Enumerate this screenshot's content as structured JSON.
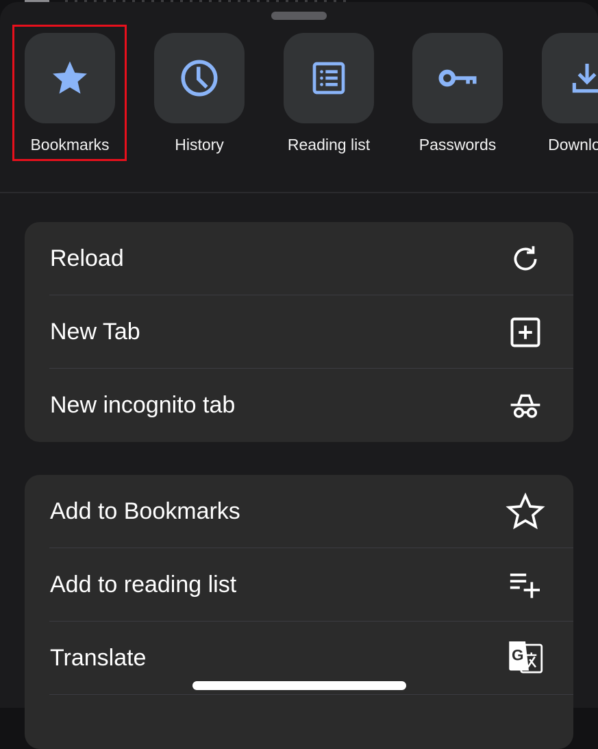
{
  "sheet": {
    "shortcuts": [
      {
        "id": "bookmarks",
        "label": "Bookmarks",
        "icon": "star-filled-icon"
      },
      {
        "id": "history",
        "label": "History",
        "icon": "clock-icon"
      },
      {
        "id": "reading-list",
        "label": "Reading list",
        "icon": "list-icon"
      },
      {
        "id": "passwords",
        "label": "Passwords",
        "icon": "key-icon"
      },
      {
        "id": "downloads",
        "label": "Downloads",
        "icon": "download-icon"
      }
    ],
    "highlighted_shortcut": "Bookmarks",
    "groups": [
      {
        "items": [
          {
            "label": "Reload",
            "icon": "reload-icon"
          },
          {
            "label": "New Tab",
            "icon": "new-tab-icon"
          },
          {
            "label": "New incognito tab",
            "icon": "incognito-icon"
          }
        ]
      },
      {
        "items": [
          {
            "label": "Add to Bookmarks",
            "icon": "star-outline-icon"
          },
          {
            "label": "Add to reading list",
            "icon": "add-to-list-icon"
          },
          {
            "label": "Translate",
            "icon": "translate-icon"
          }
        ]
      }
    ]
  },
  "colors": {
    "accent": "#8ab4f8",
    "highlight_border": "#e8101c",
    "sheet_bg": "#1b1b1d",
    "tile_bg": "#323436",
    "group_bg": "#2b2b2b"
  }
}
